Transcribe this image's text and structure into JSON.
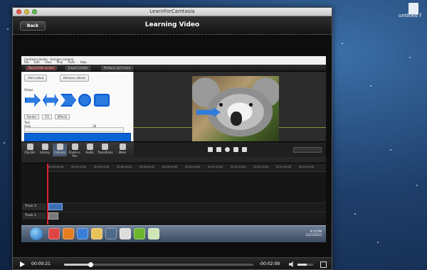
{
  "desktop": {
    "file_label": "untitled f"
  },
  "window": {
    "title": "LearnForCamtasia",
    "back_label": "Back",
    "header_title": "Learning Video"
  },
  "camtasia": {
    "app_title": "Camtasia Studio - Sample.camproj",
    "menu": [
      "File",
      "Edit",
      "View",
      "Play",
      "Tools",
      "Help"
    ],
    "toolbar": [
      "Record the screen",
      "Import media",
      "Produce and share"
    ],
    "task_buttons": [
      "Add callout",
      "Remove callout"
    ],
    "shape_label": "Shape",
    "text_label": "Text",
    "font_name": "Arial",
    "font_size": "18",
    "selects": [
      "Border",
      "Fill",
      "Effects"
    ],
    "clip_bin": [
      "Clip Bin",
      "Library",
      "Callouts",
      "Zoom-n-Pan",
      "Audio",
      "Transitions",
      "More"
    ],
    "tracks": [
      "Track 2",
      "Track 1"
    ],
    "ruler_ticks": [
      "00:00:00;00",
      "00:00:10;00",
      "00:00:20;00",
      "00:00:30;00",
      "00:00:40;00",
      "00:00:50;00",
      "00:01:00;00",
      "00:01:10;00",
      "00:01:20;00",
      "00:01:30;00",
      "00:01:40;00",
      "00:01:50;00"
    ],
    "tray_time": "9:15 PM",
    "tray_date": "12/21/2015"
  },
  "player": {
    "elapsed": "00:00:21",
    "remaining": "-00:02:09",
    "progress_fraction": 0.14,
    "volume_fraction": 0.6
  },
  "colors": {
    "accent_blue": "#0b63d1",
    "playhead_red": "#dd2233"
  }
}
